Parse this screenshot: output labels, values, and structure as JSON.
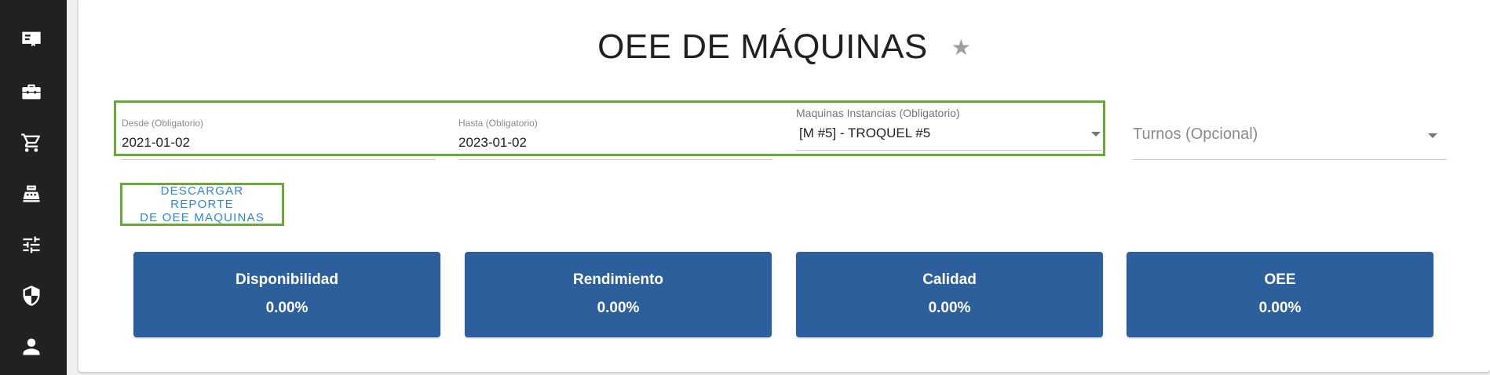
{
  "sidebar": {
    "items": [
      {
        "icon": "certificate-icon"
      },
      {
        "icon": "toolbox-icon"
      },
      {
        "icon": "cart-icon"
      },
      {
        "icon": "cash-register-icon"
      },
      {
        "icon": "tune-icon"
      },
      {
        "icon": "shield-icon"
      },
      {
        "icon": "account-icon"
      }
    ]
  },
  "header": {
    "title": "OEE DE MÁQUINAS",
    "star_glyph": "★"
  },
  "filters": {
    "desde": {
      "label": "Desde (Obligatorio)",
      "value": "2021-01-02"
    },
    "hasta": {
      "label": "Hasta (Obligatorio)",
      "value": "2023-01-02"
    },
    "maquinas": {
      "label": "Maquinas Instancias (Obligatorio)",
      "value": "[M #5] - TROQUEL #5"
    },
    "turnos": {
      "placeholder": "Turnos (Opcional)"
    }
  },
  "actions": {
    "download_line1": "DESCARGAR REPORTE",
    "download_line2": "DE OEE MAQUINAS"
  },
  "kpis": [
    {
      "label": "Disponibilidad",
      "value": "0.00%"
    },
    {
      "label": "Rendimiento",
      "value": "0.00%"
    },
    {
      "label": "Calidad",
      "value": "0.00%"
    },
    {
      "label": "OEE",
      "value": "0.00%"
    }
  ],
  "colors": {
    "sidebar": "#212121",
    "kpi_card": "#2c5f9c",
    "highlight": "#6aa837",
    "link": "#2f86d6"
  }
}
